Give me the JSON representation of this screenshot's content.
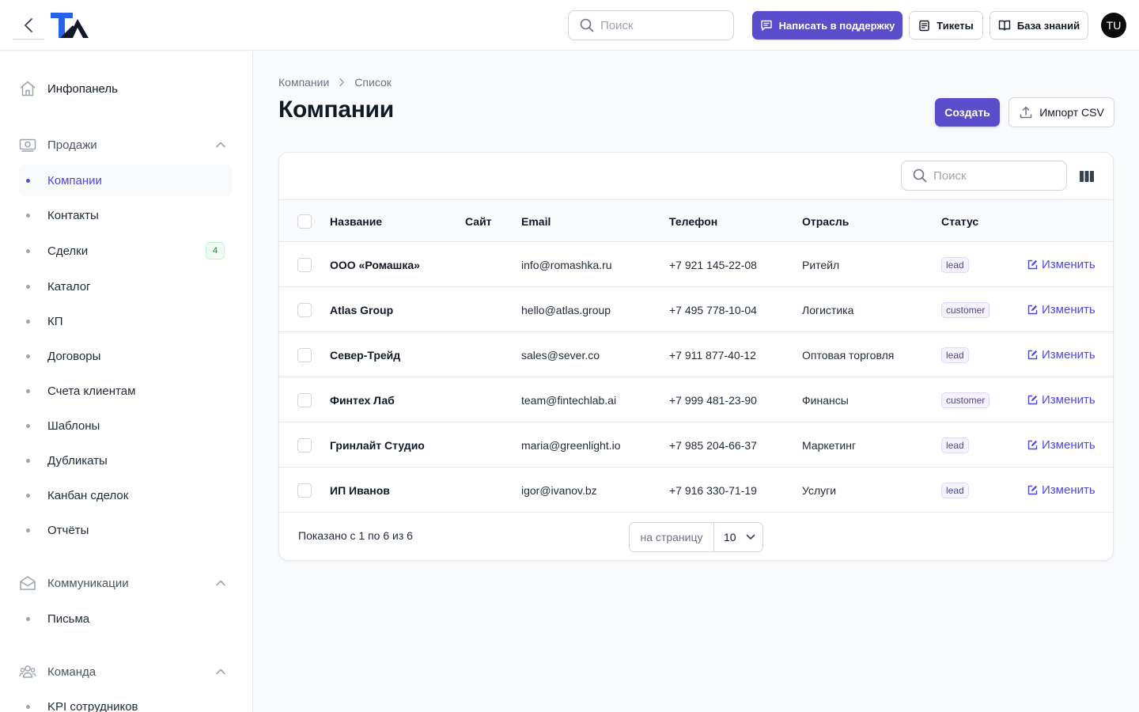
{
  "topbar": {
    "search_placeholder": "Поиск",
    "support_label": "Написать в поддержку",
    "tickets_label": "Тикеты",
    "kb_label": "База знаний",
    "avatar_initials": "TU",
    "accent_color": "#5b4ccc"
  },
  "sidebar": {
    "dashboard": "Инфопанель",
    "sales": {
      "label": "Продажи",
      "items": [
        {
          "label": "Компании",
          "active": true
        },
        {
          "label": "Контакты"
        },
        {
          "label": "Сделки",
          "badge": "4"
        },
        {
          "label": "Каталог"
        },
        {
          "label": "КП"
        },
        {
          "label": "Договоры"
        },
        {
          "label": "Счета клиентам"
        },
        {
          "label": "Шаблоны"
        },
        {
          "label": "Дубликаты"
        },
        {
          "label": "Канбан сделок"
        },
        {
          "label": "Отчёты"
        }
      ]
    },
    "comms": {
      "label": "Коммуникации",
      "items": [
        {
          "label": "Письма"
        }
      ]
    },
    "team": {
      "label": "Команда",
      "items": [
        {
          "label": "KPI сотрудников"
        }
      ]
    }
  },
  "main": {
    "breadcrumb": [
      "Компании",
      "Список"
    ],
    "title": "Компании",
    "create_label": "Создать",
    "import_label": "Импорт CSV",
    "table_search_placeholder": "Поиск",
    "columns": [
      "Название",
      "Сайт",
      "Email",
      "Телефон",
      "Отрасль",
      "Статус"
    ],
    "rows": [
      {
        "name": "ООО «Ромашка»",
        "site": "",
        "email": "info@romashka.ru",
        "phone": "+7 921 145-22-08",
        "industry": "Ритейл",
        "status": "lead",
        "action": "Изменить"
      },
      {
        "name": "Atlas Group",
        "site": "",
        "email": "hello@atlas.group",
        "phone": "+7 495 778-10-04",
        "industry": "Логистика",
        "status": "customer",
        "action": "Изменить"
      },
      {
        "name": "Север-Трейд",
        "site": "",
        "email": "sales@sever.co",
        "phone": "+7 911 877-40-12",
        "industry": "Оптовая торговля",
        "status": "lead",
        "action": "Изменить"
      },
      {
        "name": "Финтех Лаб",
        "site": "",
        "email": "team@fintechlab.ai",
        "phone": "+7 999 481-23-90",
        "industry": "Финансы",
        "status": "customer",
        "action": "Изменить"
      },
      {
        "name": "Гринлайт Студио",
        "site": "",
        "email": "maria@greenlight.io",
        "phone": "+7 985 204-66-37",
        "industry": "Маркетинг",
        "status": "lead",
        "action": "Изменить"
      },
      {
        "name": "ИП Иванов",
        "site": "",
        "email": "igor@ivanov.bz",
        "phone": "+7 916 330-71-19",
        "industry": "Услуги",
        "status": "lead",
        "action": "Изменить"
      }
    ],
    "footer": {
      "summary": "Показано с 1 по 6 из 6",
      "per_page_label": "на страницу",
      "per_page_value": "10"
    }
  }
}
